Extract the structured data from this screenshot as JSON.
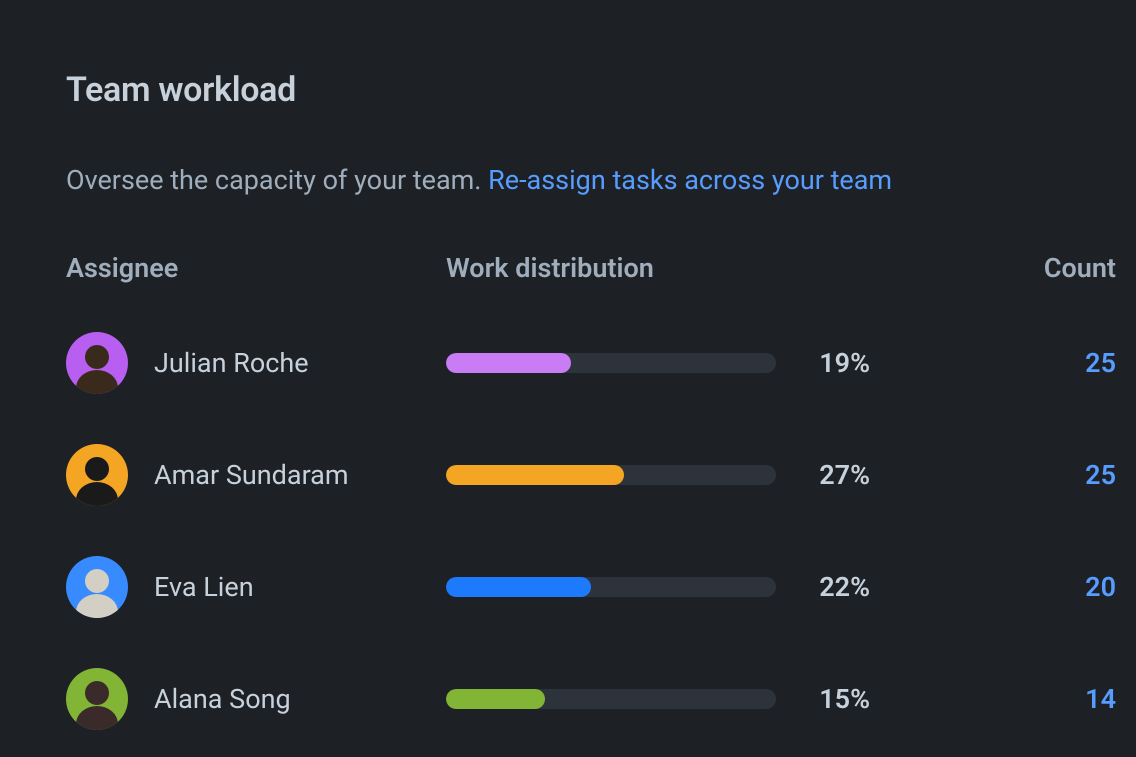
{
  "header": {
    "title": "Team workload",
    "subtitle_prefix": "Oversee the capacity of your team. ",
    "subtitle_link": "Re-assign tasks across your team"
  },
  "columns": {
    "assignee": "Assignee",
    "work_distribution": "Work distribution",
    "count": "Count"
  },
  "bar_max_percent": 50,
  "rows": [
    {
      "name": "Julian Roche",
      "percent": 19,
      "count": 25,
      "color": "#c97cf4",
      "avatar_bg": "#b85ef0",
      "avatar_fg": "#3a2a1c"
    },
    {
      "name": "Amar Sundaram",
      "percent": 27,
      "count": 25,
      "color": "#f5a524",
      "avatar_bg": "#f5a524",
      "avatar_fg": "#1a1a1a"
    },
    {
      "name": "Eva Lien",
      "percent": 22,
      "count": 20,
      "color": "#1d7afc",
      "avatar_bg": "#388bff",
      "avatar_fg": "#d4cfc4"
    },
    {
      "name": "Alana Song",
      "percent": 15,
      "count": 14,
      "color": "#82b536",
      "avatar_bg": "#82b536",
      "avatar_fg": "#3a2a2a"
    }
  ],
  "chart_data": {
    "type": "bar",
    "title": "Team workload — Work distribution",
    "xlabel": "Work distribution (%)",
    "ylabel": "Assignee",
    "categories": [
      "Julian Roche",
      "Amar Sundaram",
      "Eva Lien",
      "Alana Song"
    ],
    "series": [
      {
        "name": "Percent",
        "values": [
          19,
          27,
          22,
          15
        ]
      },
      {
        "name": "Count",
        "values": [
          25,
          25,
          20,
          14
        ]
      }
    ],
    "xlim": [
      0,
      50
    ]
  }
}
